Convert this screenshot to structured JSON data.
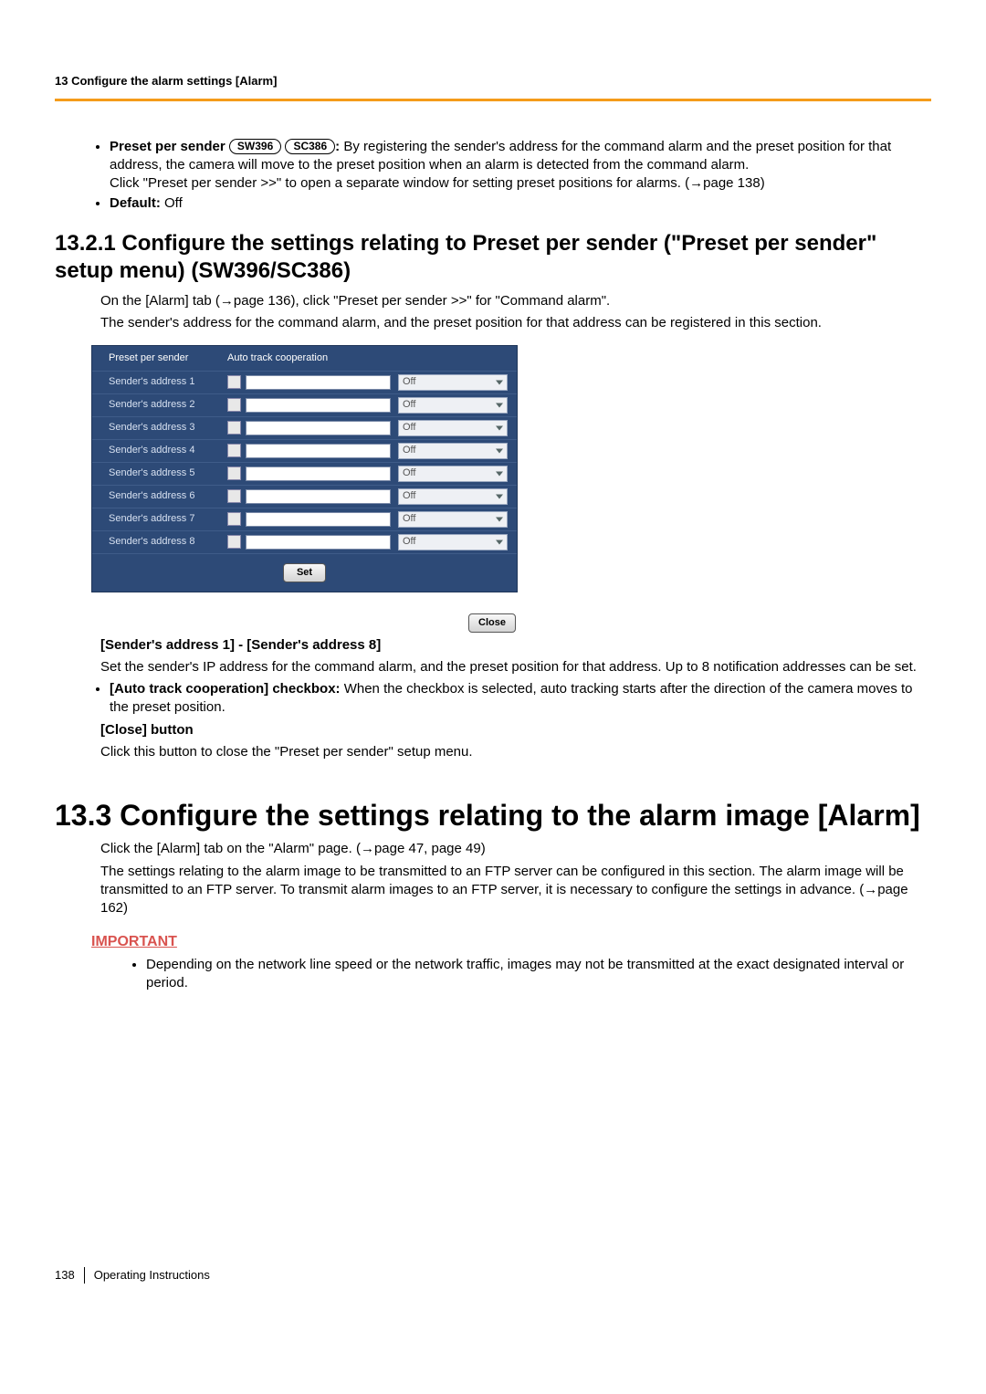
{
  "header": {
    "title": "13 Configure the alarm settings [Alarm]"
  },
  "bullets_top": {
    "preset_label": "Preset per sender",
    "badge1": "SW396",
    "badge2": "SC386",
    "preset_text_1": " By registering the sender's address for the command alarm and the preset position for that address, the camera will move to the preset position when an alarm is detected from the command alarm.",
    "preset_text_2": "Click \"Preset per sender >>\" to open a separate window for setting preset positions for alarms. (",
    "preset_text_3": "page 138)",
    "default_label": "Default:",
    "default_value": " Off"
  },
  "sec_13_2_1": {
    "title": "13.2.1  Configure the settings relating to Preset per sender (\"Preset per sender\" setup menu) (SW396/SC386)",
    "p1a": "On the [Alarm] tab (",
    "p1b": "page 136), click \"Preset per sender >>\" for \"Command alarm\".",
    "p2": "The sender's address for the command alarm, and the preset position for that address can be registered in this section."
  },
  "ui": {
    "col1": "Preset per sender",
    "col2": "Auto track cooperation",
    "rows": [
      {
        "label": "Sender's address 1",
        "sel": "Off"
      },
      {
        "label": "Sender's address 2",
        "sel": "Off"
      },
      {
        "label": "Sender's address 3",
        "sel": "Off"
      },
      {
        "label": "Sender's address 4",
        "sel": "Off"
      },
      {
        "label": "Sender's address 5",
        "sel": "Off"
      },
      {
        "label": "Sender's address 6",
        "sel": "Off"
      },
      {
        "label": "Sender's address 7",
        "sel": "Off"
      },
      {
        "label": "Sender's address 8",
        "sel": "Off"
      }
    ],
    "set_btn": "Set",
    "close_btn": "Close"
  },
  "after_ui": {
    "h1": "[Sender's address 1] - [Sender's address 8]",
    "p1": "Set the sender's IP address for the command alarm, and the preset position for that address. Up to 8 notification addresses can be set.",
    "chk_label": "[Auto track cooperation] checkbox:",
    "chk_text": " When the checkbox is selected, auto tracking starts after the direction of the camera moves to the preset position.",
    "close_h": "[Close] button",
    "close_p": "Click this button to close the \"Preset per sender\" setup menu."
  },
  "sec_13_3": {
    "title": "13.3  Configure the settings relating to the alarm image [Alarm]",
    "p1a": "Click the [Alarm] tab on the \"Alarm\" page. (",
    "p1b": "page 47, page 49)",
    "p2": "The settings relating to the alarm image to be transmitted to an FTP server can be configured in this section. The alarm image will be transmitted to an FTP server. To transmit alarm images to an FTP server, it is necessary to configure the settings in advance. (",
    "p2b": "page 162)",
    "important_label": "IMPORTANT",
    "important_text": "Depending on the network line speed or the network traffic, images may not be transmitted at the exact designated interval or period."
  },
  "footer": {
    "page": "138",
    "doc": "Operating Instructions"
  }
}
